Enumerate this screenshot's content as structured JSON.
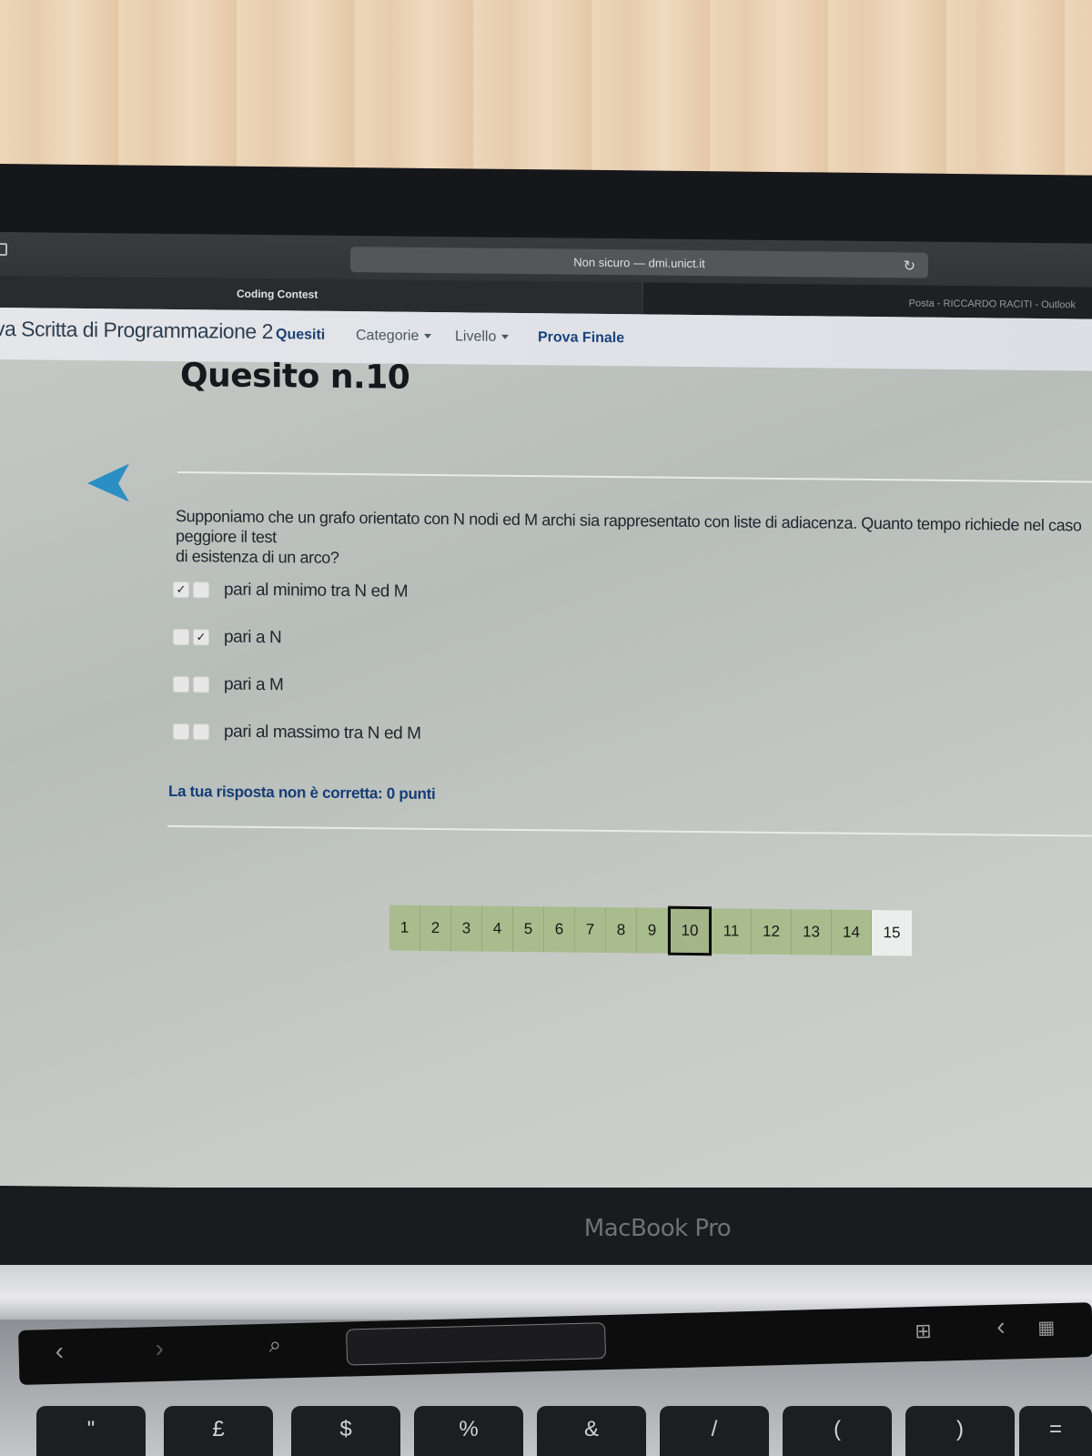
{
  "browser": {
    "address": "Non sicuro — dmi.unict.it",
    "tabs": [
      {
        "label": "Coding Contest"
      },
      {
        "label": "Posta - RICCARDO RACITI - Outlook"
      }
    ]
  },
  "navbar": {
    "site_title": "va Scritta di Programmazione 2",
    "items": [
      {
        "label": "Quesiti"
      },
      {
        "label": "Categorie"
      },
      {
        "label": "Livello"
      },
      {
        "label": "Prova Finale"
      }
    ]
  },
  "question": {
    "title": "Quesito n.10",
    "text_line1": "Supponiamo che un grafo orientato con N nodi ed M archi sia rappresentato con liste di adiacenza. Quanto tempo richiede nel caso peggiore il test",
    "text_line2": "di esistenza di un arco?",
    "options": [
      {
        "label": "pari al minimo tra N ed M",
        "box1": "✓",
        "box2": ""
      },
      {
        "label": "pari a N",
        "box1": "",
        "box2": "✓"
      },
      {
        "label": "pari a M",
        "box1": "",
        "box2": ""
      },
      {
        "label": "pari al massimo tra N ed M",
        "box1": "",
        "box2": ""
      }
    ],
    "feedback": "La tua risposta non è corretta: 0 punti"
  },
  "pagination": {
    "pages": [
      "1",
      "2",
      "3",
      "4",
      "5",
      "6",
      "7",
      "8",
      "9",
      "10",
      "11",
      "12",
      "13",
      "14",
      "15"
    ],
    "current": "10"
  },
  "device": {
    "brand": "MacBook Pro",
    "keys": [
      "\"",
      "£",
      "$",
      "%",
      "&",
      "/",
      "(",
      ")",
      "="
    ]
  },
  "colors": {
    "answered_page": "#a9bc8e",
    "unanswered_page": "#eceeed",
    "back_arrow": "#2b8fc4",
    "feedback_text": "#153d75"
  }
}
